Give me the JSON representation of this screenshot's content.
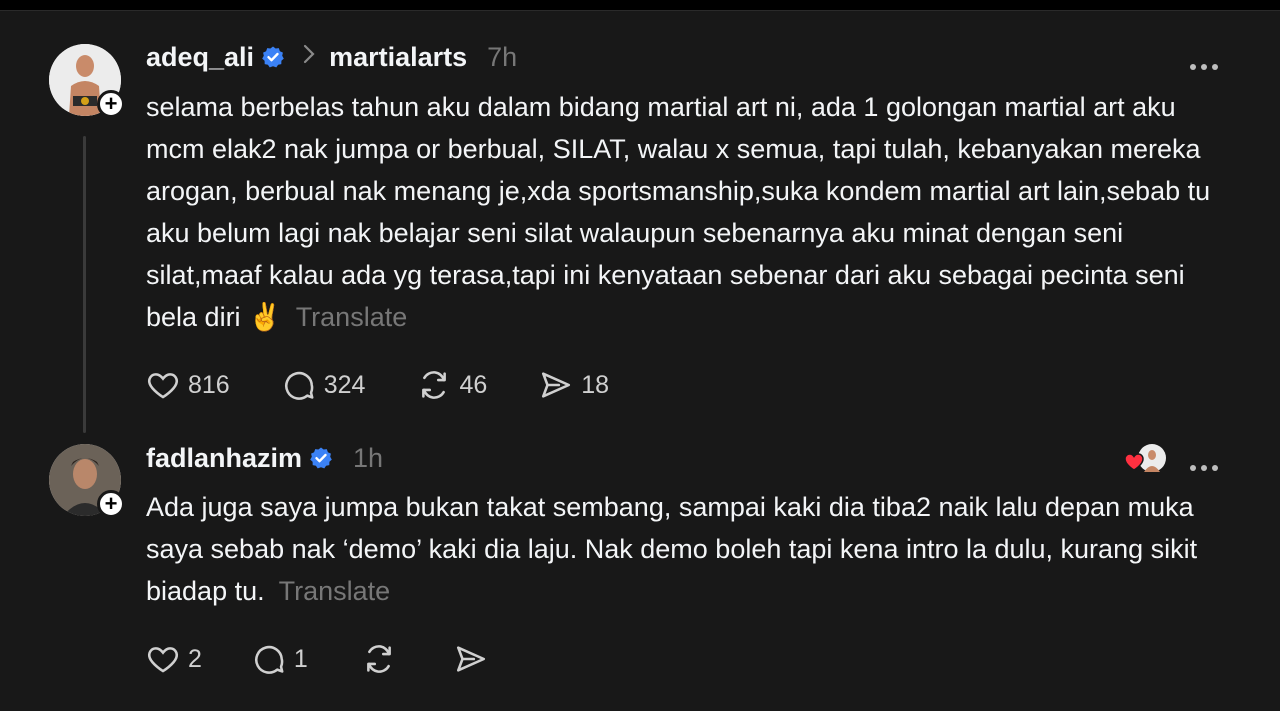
{
  "posts": [
    {
      "username": "adeq_ali",
      "community": "martialarts",
      "time": "7h",
      "text": "selama berbelas tahun aku dalam bidang martial art ni, ada 1 golongan martial art aku mcm elak2 nak jumpa or berbual, SILAT, walau x semua, tapi tulah, kebanyakan mereka arogan, berbual nak menang je,xda sportsmanship,suka kondem martial art lain,sebab tu aku belum lagi nak belajar seni silat walaupun sebenarnya aku minat dengan seni silat,maaf kalau ada yg terasa,tapi ini kenyataan sebenar dari aku sebagai pecinta seni bela diri ✌️",
      "translate": "Translate",
      "likes": "816",
      "replies": "324",
      "reposts": "46",
      "shares": "18"
    },
    {
      "username": "fadlanhazim",
      "time": "1h",
      "text": "Ada juga saya jumpa bukan takat sembang, sampai kaki dia tiba2 naik lalu depan muka saya sebab nak ‘demo’ kaki dia laju. Nak demo boleh tapi kena intro la dulu, kurang sikit biadap tu.",
      "translate": "Translate",
      "likes": "2",
      "replies": "1"
    }
  ],
  "colors": {
    "background": "#181818",
    "verified": "#3b82f6",
    "heart": "#ff3040"
  },
  "icons": [
    "plus-icon",
    "verified-badge-icon",
    "chevron-right-icon",
    "more-icon",
    "heart-icon",
    "comment-icon",
    "repost-icon",
    "share-icon"
  ]
}
